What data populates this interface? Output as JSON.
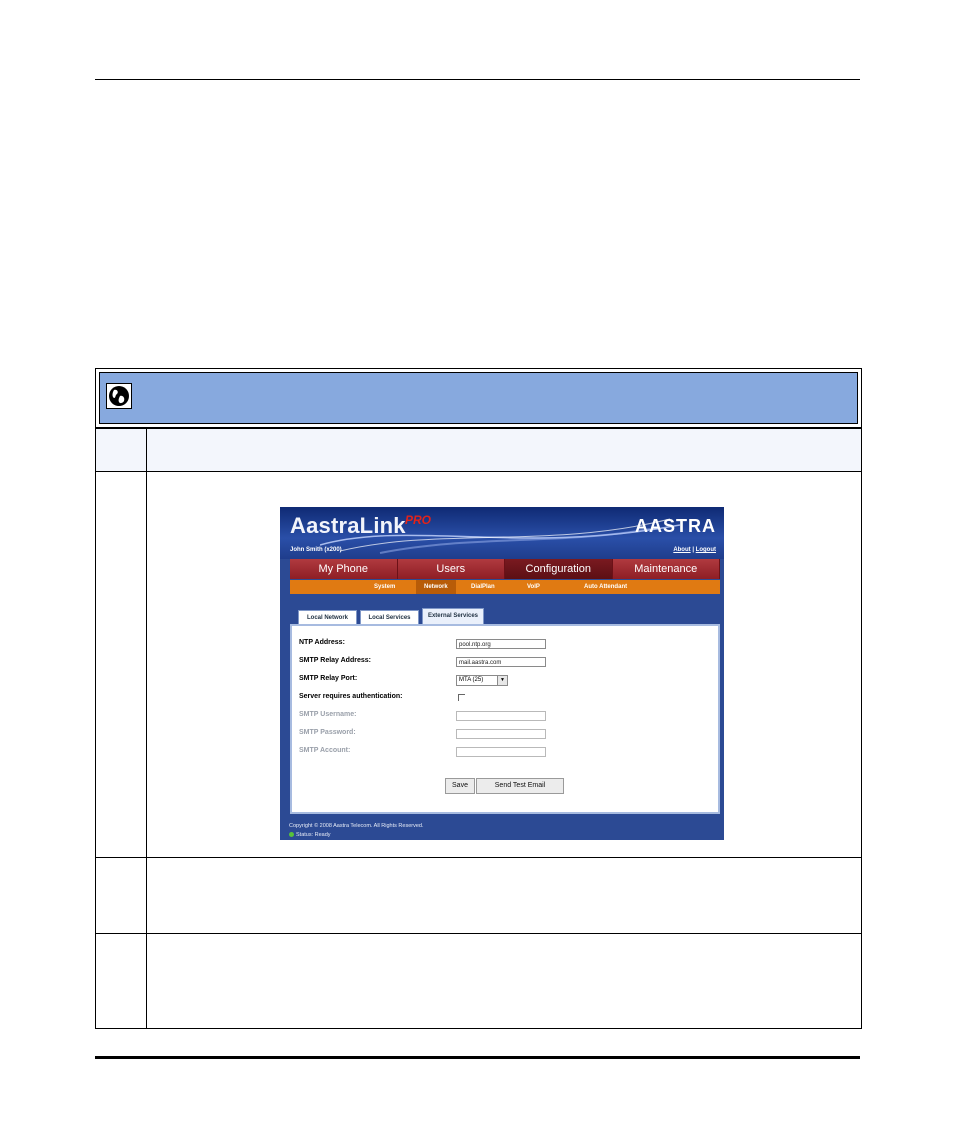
{
  "screenshot": {
    "logo": "AastraLink",
    "logo_suffix": "PRO",
    "brand": "AASTRA",
    "user": "John Smith (x200)",
    "links": {
      "about": "About",
      "separator": "|",
      "logout": "Logout"
    },
    "main_nav": [
      "My Phone",
      "Users",
      "Configuration",
      "Maintenance"
    ],
    "main_nav_active": "Configuration",
    "sub_nav": [
      "System",
      "Network",
      "DialPlan",
      "VoIP",
      "Auto Attendant"
    ],
    "sub_nav_active": "Network",
    "tabs": [
      "Local Network",
      "Local Services",
      "External Services"
    ],
    "tab_active": "External Services",
    "form": {
      "ntp_label": "NTP Address:",
      "ntp_value": "pool.ntp.org",
      "smtp_relay_label": "SMTP Relay Address:",
      "smtp_relay_value": "mail.aastra.com",
      "smtp_port_label": "SMTP Relay Port:",
      "smtp_port_value": "MTA (25)",
      "auth_label": "Server requires authentication:",
      "username_label": "SMTP Username:",
      "password_label": "SMTP Password:",
      "account_label": "SMTP Account:",
      "save_label": "Save",
      "test_email_label": "Send Test Email"
    },
    "copyright": "Copyright © 2008 Aastra Telecom. All Rights Reserved.",
    "status": "Status: Ready"
  }
}
